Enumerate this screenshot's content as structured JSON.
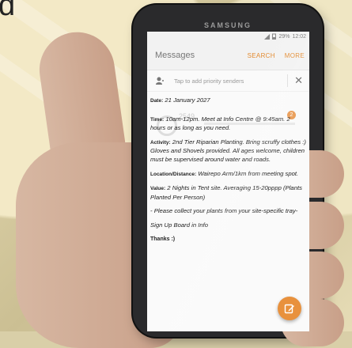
{
  "corner_text": "d",
  "phone": {
    "brand": "SAMSUNG"
  },
  "status": {
    "battery": "29%",
    "time": "12:02"
  },
  "appbar": {
    "title": "Messages",
    "search": "SEARCH",
    "more": "MORE"
  },
  "priority": {
    "text": "Tap to add priority senders"
  },
  "ghost": {
    "number": "2549",
    "badge": "2"
  },
  "message": {
    "date_label": "Date:",
    "date_value": " 21 January 2027",
    "time_label": "Time:",
    "time_value": " 10am-12pm. Meet at Info Centre @ 9:45am. 2 hours or as long as you need.",
    "activity_label": "Activity:",
    "activity_value": " 2nd Tier Riparian Planting. Bring scruffy clothes :) Gloves and Shovels provided. All ages welcome, children must be supervised around water and roads.",
    "location_label": "Location/Distance:",
    "location_value": " Wairepo Arm/1km from meeting spot.",
    "value_label": "Value:",
    "value_value": " 2 Nights in Tent site. Averaging 15-20pppp (Plants Planted Per Person)",
    "note": "- Please collect your plants from your site-specific tray-",
    "signup": "Sign Up Board in Info",
    "thanks": "Thanks :)"
  },
  "colors": {
    "accent": "#e8913d",
    "screen_bg": "#fafafa"
  }
}
